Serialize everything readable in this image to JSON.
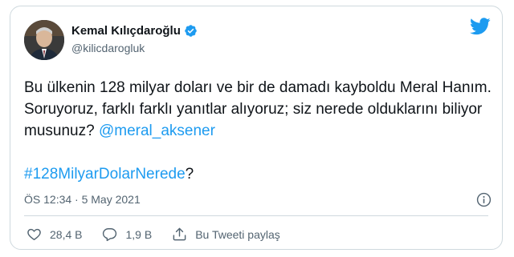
{
  "author": {
    "name": "Kemal Kılıçdaroğlu",
    "handle": "@kilicdarogluk"
  },
  "tweet": {
    "text_main": "Bu ülkenin 128 milyar doları ve bir de damadı kayboldu Meral Hanım. Soruyoruz, farklı farklı yanıtlar alıyoruz; siz nerede olduklarını biliyor musunuz? ",
    "mention": "@meral_aksener",
    "hashtag": "#128MilyarDolarNerede",
    "hashtag_suffix": "?"
  },
  "timestamp": "ÖS 12:34 · 5 May 2021",
  "actions": {
    "likes": "28,4 B",
    "replies": "1,9 B",
    "share": "Bu Tweeti paylaş"
  },
  "colors": {
    "accent": "#1d9bf0",
    "text": "#0f1419",
    "secondary": "#536471",
    "border": "#cfd9de"
  },
  "icons": [
    "twitter-bird-icon",
    "verified-badge-icon",
    "info-icon",
    "heart-icon",
    "reply-icon",
    "share-icon"
  ]
}
